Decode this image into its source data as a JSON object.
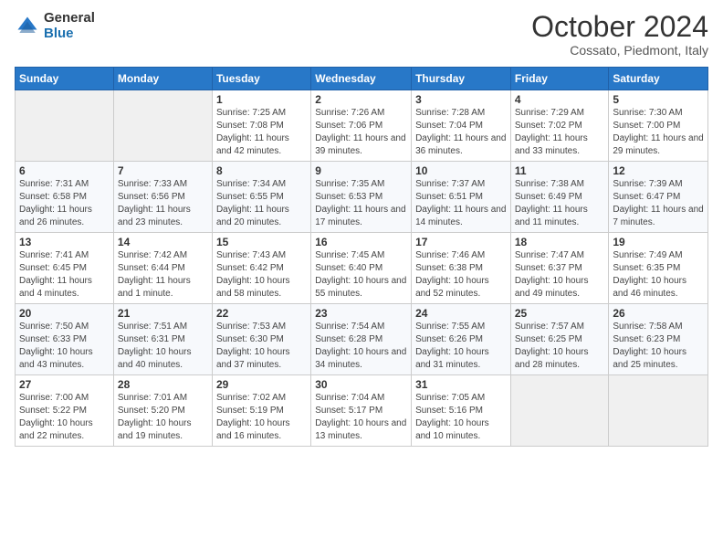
{
  "header": {
    "logo_general": "General",
    "logo_blue": "Blue",
    "month_title": "October 2024",
    "location": "Cossato, Piedmont, Italy"
  },
  "days_of_week": [
    "Sunday",
    "Monday",
    "Tuesday",
    "Wednesday",
    "Thursday",
    "Friday",
    "Saturday"
  ],
  "weeks": [
    [
      {
        "num": "",
        "sunrise": "",
        "sunset": "",
        "daylight": ""
      },
      {
        "num": "",
        "sunrise": "",
        "sunset": "",
        "daylight": ""
      },
      {
        "num": "1",
        "sunrise": "Sunrise: 7:25 AM",
        "sunset": "Sunset: 7:08 PM",
        "daylight": "Daylight: 11 hours and 42 minutes."
      },
      {
        "num": "2",
        "sunrise": "Sunrise: 7:26 AM",
        "sunset": "Sunset: 7:06 PM",
        "daylight": "Daylight: 11 hours and 39 minutes."
      },
      {
        "num": "3",
        "sunrise": "Sunrise: 7:28 AM",
        "sunset": "Sunset: 7:04 PM",
        "daylight": "Daylight: 11 hours and 36 minutes."
      },
      {
        "num": "4",
        "sunrise": "Sunrise: 7:29 AM",
        "sunset": "Sunset: 7:02 PM",
        "daylight": "Daylight: 11 hours and 33 minutes."
      },
      {
        "num": "5",
        "sunrise": "Sunrise: 7:30 AM",
        "sunset": "Sunset: 7:00 PM",
        "daylight": "Daylight: 11 hours and 29 minutes."
      }
    ],
    [
      {
        "num": "6",
        "sunrise": "Sunrise: 7:31 AM",
        "sunset": "Sunset: 6:58 PM",
        "daylight": "Daylight: 11 hours and 26 minutes."
      },
      {
        "num": "7",
        "sunrise": "Sunrise: 7:33 AM",
        "sunset": "Sunset: 6:56 PM",
        "daylight": "Daylight: 11 hours and 23 minutes."
      },
      {
        "num": "8",
        "sunrise": "Sunrise: 7:34 AM",
        "sunset": "Sunset: 6:55 PM",
        "daylight": "Daylight: 11 hours and 20 minutes."
      },
      {
        "num": "9",
        "sunrise": "Sunrise: 7:35 AM",
        "sunset": "Sunset: 6:53 PM",
        "daylight": "Daylight: 11 hours and 17 minutes."
      },
      {
        "num": "10",
        "sunrise": "Sunrise: 7:37 AM",
        "sunset": "Sunset: 6:51 PM",
        "daylight": "Daylight: 11 hours and 14 minutes."
      },
      {
        "num": "11",
        "sunrise": "Sunrise: 7:38 AM",
        "sunset": "Sunset: 6:49 PM",
        "daylight": "Daylight: 11 hours and 11 minutes."
      },
      {
        "num": "12",
        "sunrise": "Sunrise: 7:39 AM",
        "sunset": "Sunset: 6:47 PM",
        "daylight": "Daylight: 11 hours and 7 minutes."
      }
    ],
    [
      {
        "num": "13",
        "sunrise": "Sunrise: 7:41 AM",
        "sunset": "Sunset: 6:45 PM",
        "daylight": "Daylight: 11 hours and 4 minutes."
      },
      {
        "num": "14",
        "sunrise": "Sunrise: 7:42 AM",
        "sunset": "Sunset: 6:44 PM",
        "daylight": "Daylight: 11 hours and 1 minute."
      },
      {
        "num": "15",
        "sunrise": "Sunrise: 7:43 AM",
        "sunset": "Sunset: 6:42 PM",
        "daylight": "Daylight: 10 hours and 58 minutes."
      },
      {
        "num": "16",
        "sunrise": "Sunrise: 7:45 AM",
        "sunset": "Sunset: 6:40 PM",
        "daylight": "Daylight: 10 hours and 55 minutes."
      },
      {
        "num": "17",
        "sunrise": "Sunrise: 7:46 AM",
        "sunset": "Sunset: 6:38 PM",
        "daylight": "Daylight: 10 hours and 52 minutes."
      },
      {
        "num": "18",
        "sunrise": "Sunrise: 7:47 AM",
        "sunset": "Sunset: 6:37 PM",
        "daylight": "Daylight: 10 hours and 49 minutes."
      },
      {
        "num": "19",
        "sunrise": "Sunrise: 7:49 AM",
        "sunset": "Sunset: 6:35 PM",
        "daylight": "Daylight: 10 hours and 46 minutes."
      }
    ],
    [
      {
        "num": "20",
        "sunrise": "Sunrise: 7:50 AM",
        "sunset": "Sunset: 6:33 PM",
        "daylight": "Daylight: 10 hours and 43 minutes."
      },
      {
        "num": "21",
        "sunrise": "Sunrise: 7:51 AM",
        "sunset": "Sunset: 6:31 PM",
        "daylight": "Daylight: 10 hours and 40 minutes."
      },
      {
        "num": "22",
        "sunrise": "Sunrise: 7:53 AM",
        "sunset": "Sunset: 6:30 PM",
        "daylight": "Daylight: 10 hours and 37 minutes."
      },
      {
        "num": "23",
        "sunrise": "Sunrise: 7:54 AM",
        "sunset": "Sunset: 6:28 PM",
        "daylight": "Daylight: 10 hours and 34 minutes."
      },
      {
        "num": "24",
        "sunrise": "Sunrise: 7:55 AM",
        "sunset": "Sunset: 6:26 PM",
        "daylight": "Daylight: 10 hours and 31 minutes."
      },
      {
        "num": "25",
        "sunrise": "Sunrise: 7:57 AM",
        "sunset": "Sunset: 6:25 PM",
        "daylight": "Daylight: 10 hours and 28 minutes."
      },
      {
        "num": "26",
        "sunrise": "Sunrise: 7:58 AM",
        "sunset": "Sunset: 6:23 PM",
        "daylight": "Daylight: 10 hours and 25 minutes."
      }
    ],
    [
      {
        "num": "27",
        "sunrise": "Sunrise: 7:00 AM",
        "sunset": "Sunset: 5:22 PM",
        "daylight": "Daylight: 10 hours and 22 minutes."
      },
      {
        "num": "28",
        "sunrise": "Sunrise: 7:01 AM",
        "sunset": "Sunset: 5:20 PM",
        "daylight": "Daylight: 10 hours and 19 minutes."
      },
      {
        "num": "29",
        "sunrise": "Sunrise: 7:02 AM",
        "sunset": "Sunset: 5:19 PM",
        "daylight": "Daylight: 10 hours and 16 minutes."
      },
      {
        "num": "30",
        "sunrise": "Sunrise: 7:04 AM",
        "sunset": "Sunset: 5:17 PM",
        "daylight": "Daylight: 10 hours and 13 minutes."
      },
      {
        "num": "31",
        "sunrise": "Sunrise: 7:05 AM",
        "sunset": "Sunset: 5:16 PM",
        "daylight": "Daylight: 10 hours and 10 minutes."
      },
      {
        "num": "",
        "sunrise": "",
        "sunset": "",
        "daylight": ""
      },
      {
        "num": "",
        "sunrise": "",
        "sunset": "",
        "daylight": ""
      }
    ]
  ]
}
